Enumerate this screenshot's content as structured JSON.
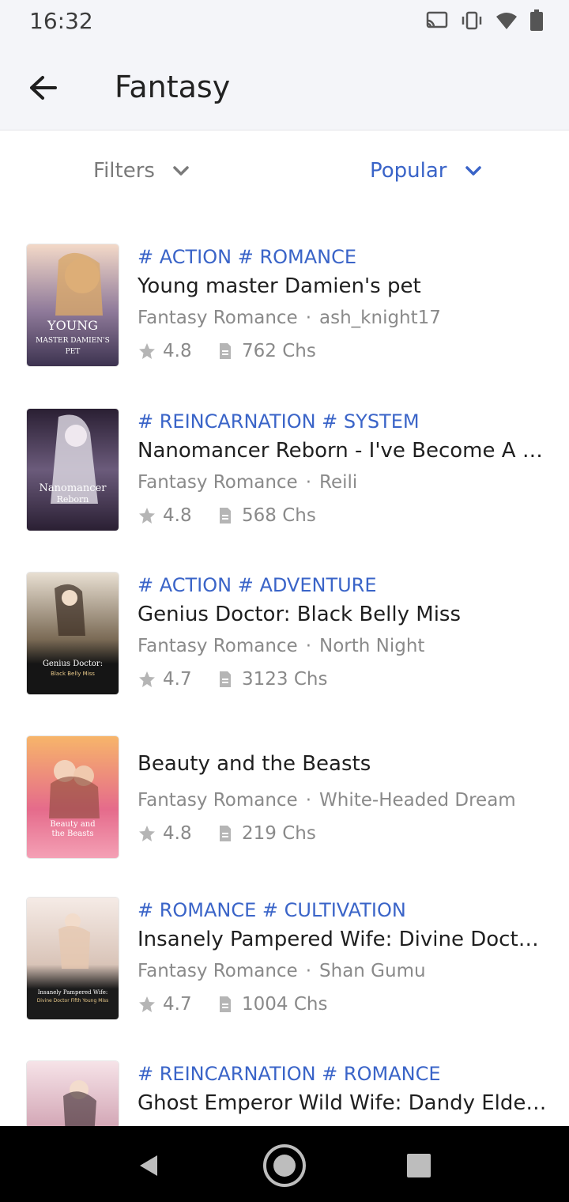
{
  "status_bar": {
    "time": "16:32",
    "icons": [
      "cast-icon",
      "vibrate-icon",
      "wifi-icon",
      "battery-icon"
    ]
  },
  "app_bar": {
    "title": "Fantasy",
    "back_icon": "arrow-left-icon"
  },
  "filters": {
    "filter_label": "Filters",
    "sort_label": "Popular"
  },
  "colors": {
    "accent": "#3a64c8",
    "text_primary": "#1f1f1f",
    "text_secondary": "#8a8a8a",
    "header_bg": "#f4f5f9"
  },
  "books": [
    {
      "tags": "# ACTION # ROMANCE",
      "title": "Young master Damien's pet",
      "genre": "Fantasy Romance",
      "author": "ash_knight17",
      "rating": "4.8",
      "chapters": "762 Chs"
    },
    {
      "tags": "# REINCARNATION # SYSTEM",
      "title": "Nanomancer Reborn - I've Become A Sno...",
      "genre": "Fantasy Romance",
      "author": "Reili",
      "rating": "4.8",
      "chapters": "568 Chs"
    },
    {
      "tags": "# ACTION # ADVENTURE",
      "title": "Genius Doctor: Black Belly Miss",
      "genre": "Fantasy Romance",
      "author": "North Night",
      "rating": "4.7",
      "chapters": "3123 Chs"
    },
    {
      "tags": "",
      "title": "Beauty and the Beasts",
      "genre": "Fantasy Romance",
      "author": "White-Headed Dream",
      "rating": "4.8",
      "chapters": "219 Chs"
    },
    {
      "tags": "# ROMANCE # CULTIVATION",
      "title": "Insanely Pampered Wife: Divine Doctor F...",
      "genre": "Fantasy Romance",
      "author": "Shan Gumu",
      "rating": "4.7",
      "chapters": "1004 Chs"
    },
    {
      "tags": "# REINCARNATION # ROMANCE",
      "title": "Ghost Emperor Wild Wife: Dandy Eldest ...",
      "genre": "",
      "author": "",
      "rating": "",
      "chapters": ""
    }
  ],
  "covers": [
    {
      "lines": [
        "YOUNG",
        "MASTER DAMIEN'S",
        "PET"
      ],
      "palette": [
        "#f3d9c8",
        "#8f7a9a",
        "#3d3350"
      ]
    },
    {
      "lines": [
        "Nanomancer",
        "Reborn"
      ],
      "palette": [
        "#2a1f33",
        "#6b5b7b",
        "#d8d3de"
      ]
    },
    {
      "lines": [
        "Genius Doctor:",
        "Black Belly Miss"
      ],
      "palette": [
        "#e8dfd2",
        "#7a6a55",
        "#151515"
      ]
    },
    {
      "lines": [
        "Beauty and",
        "the Beasts"
      ],
      "palette": [
        "#f7b56a",
        "#e56b8b",
        "#f4a0b5"
      ]
    },
    {
      "lines": [
        "Insanely Pampered Wife:",
        "Divine Doctor Fifth Young Miss"
      ],
      "palette": [
        "#f5ebe6",
        "#d9c4b8",
        "#1b1b1b"
      ]
    },
    {
      "lines": [],
      "palette": [
        "#f6e3e8",
        "#cfa0b0",
        "#7b4a5a"
      ]
    }
  ],
  "nav": {
    "back": "triangle-back-icon",
    "home": "circle-home-icon",
    "recents": "square-recents-icon"
  }
}
